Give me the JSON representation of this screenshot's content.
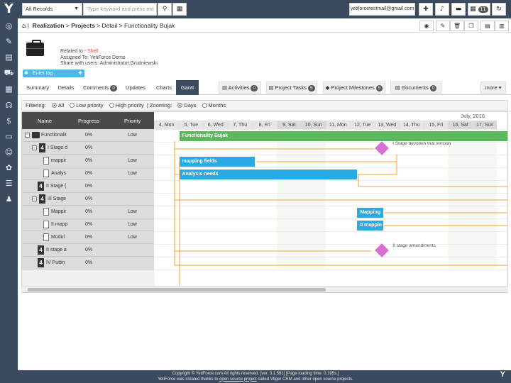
{
  "topbar": {
    "module_select": "All Records",
    "search_placeholder": "Type keyword and press ent",
    "email": "yetiforcetestmail@gmail.com",
    "calendar_badge": "11"
  },
  "breadcrumb": {
    "module": "Realization",
    "sep1": ">",
    "section": "Projects",
    "rest": "> Detail > Functionality Bujak"
  },
  "record": {
    "related_label": "Related to - ",
    "related_value": "Shell",
    "assigned": "Assigned To: YetiForce Demo",
    "shared": "Share with users: Administrator,Grudniewski",
    "tag_placeholder": "Enter tag"
  },
  "tabs": [
    {
      "label": "Summary"
    },
    {
      "label": "Details"
    },
    {
      "label": "Comments",
      "count": "0"
    },
    {
      "label": "Updates"
    },
    {
      "label": "Charts"
    },
    {
      "label": "Gantt"
    },
    {
      "label": "Activities",
      "count": "0"
    },
    {
      "label": "Project Tasks",
      "count": "5"
    },
    {
      "label": "Project Milestones",
      "count": "5"
    },
    {
      "label": "Documents",
      "count": "0"
    },
    {
      "label": "more"
    }
  ],
  "filter": {
    "label": "Filtering:",
    "opt_all": "All",
    "opt_low": "Low priority",
    "opt_high": "High priority",
    "zoom_label": "Zooming:",
    "zoom_days": "Days",
    "zoom_months": "Months"
  },
  "gantt": {
    "col_name": "Name",
    "col_progress": "Progress",
    "col_priority": "Priority",
    "month_label": "July, 2016",
    "days": [
      "4, Mon",
      "5, Tue",
      "6, Wed",
      "7, Thu",
      "8, Fri",
      "9, Sat",
      "10, Sun",
      "11, Mon",
      "12, Tue",
      "13, Wed",
      "14, Thu",
      "15, Fri",
      "16, Sat",
      "17, Sun"
    ],
    "rows": [
      {
        "name": "Functionalit",
        "progress": "0%",
        "priority": "Low"
      },
      {
        "name": "I Stage d",
        "progress": "0%",
        "priority": ""
      },
      {
        "name": "mappir",
        "progress": "0%",
        "priority": "Low"
      },
      {
        "name": "Analys",
        "progress": "0%",
        "priority": "Low"
      },
      {
        "name": "II Stage (",
        "progress": "0%",
        "priority": ""
      },
      {
        "name": "III Stage",
        "progress": "0%",
        "priority": ""
      },
      {
        "name": "Mappir",
        "progress": "0%",
        "priority": "Low"
      },
      {
        "name": "II mapp",
        "progress": "0%",
        "priority": "Low"
      },
      {
        "name": "Modul",
        "progress": "0%",
        "priority": "Low"
      },
      {
        "name": "II stage a",
        "progress": "0%",
        "priority": ""
      },
      {
        "name": "IV Puttin",
        "progress": "0%",
        "priority": ""
      }
    ],
    "bars": {
      "project": "Functionality Bujak",
      "task1": "mapping fields",
      "task2": "Analysis needs",
      "task3": "Mapping",
      "task4": "II mappin"
    },
    "milestones": {
      "m1": "I Stage devotion trial version",
      "m2": "II stage amendments"
    }
  },
  "footer": {
    "line1": "Copyright © YetiForce.com All rights reserved. [ver. 3.1.591] [Page loading time: 0.195s.]",
    "line2_a": "YetiForce was created thanks to ",
    "line2_link": "open source project",
    "line2_b": " called Vtiger CRM and other open source projects."
  },
  "colors": {
    "nav": "#3b4a5c",
    "task_bar": "#29aae2",
    "project_bar": "#5cb85c",
    "milestone": "#da70d6",
    "dependency": "#f0a030"
  }
}
